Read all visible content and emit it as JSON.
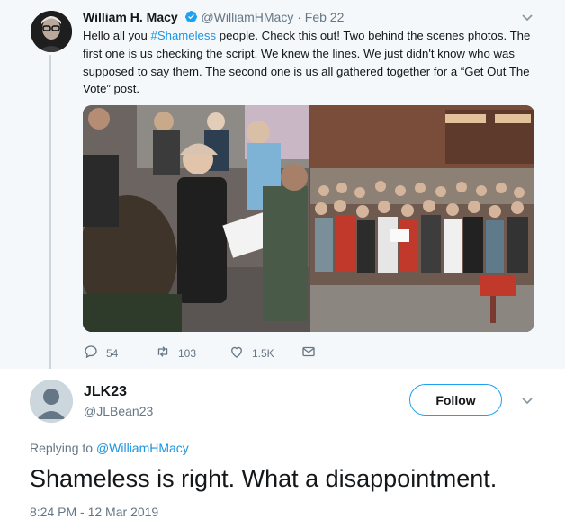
{
  "parent_tweet": {
    "name": "William H. Macy",
    "handle": "@WilliamHMacy",
    "dot": "·",
    "date": "Feb 22",
    "text_before_hashtag": "Hello all you ",
    "hashtag": "#Shameless",
    "text_after_hashtag": " people. Check this out! Two behind the scenes photos. The first one is us checking the script. We knew the lines. We just didn't know who was supposed to say them. The second one is us all gathered together for a “Get Out The Vote” post.",
    "actions": {
      "reply_count": "54",
      "retweet_count": "103",
      "like_count": "1.5K"
    }
  },
  "reply_tweet": {
    "name": "JLK23",
    "handle": "@JLBean23",
    "follow_label": "Follow",
    "replying_prefix": "Replying to ",
    "replying_to": "@WilliamHMacy",
    "text": "Shameless is right.  What a disappointment.",
    "timestamp": "8:24 PM - 12 Mar 2019"
  },
  "colors": {
    "accent": "#1da1f2",
    "link": "#1b95e0",
    "secondary_text": "#657786",
    "parent_background": "#f5f8fa"
  },
  "icons": {
    "verified": "verified-badge-icon",
    "reply": "reply-icon",
    "retweet": "retweet-icon",
    "like": "heart-icon",
    "dm": "envelope-icon",
    "more": "chevron-down-icon"
  }
}
